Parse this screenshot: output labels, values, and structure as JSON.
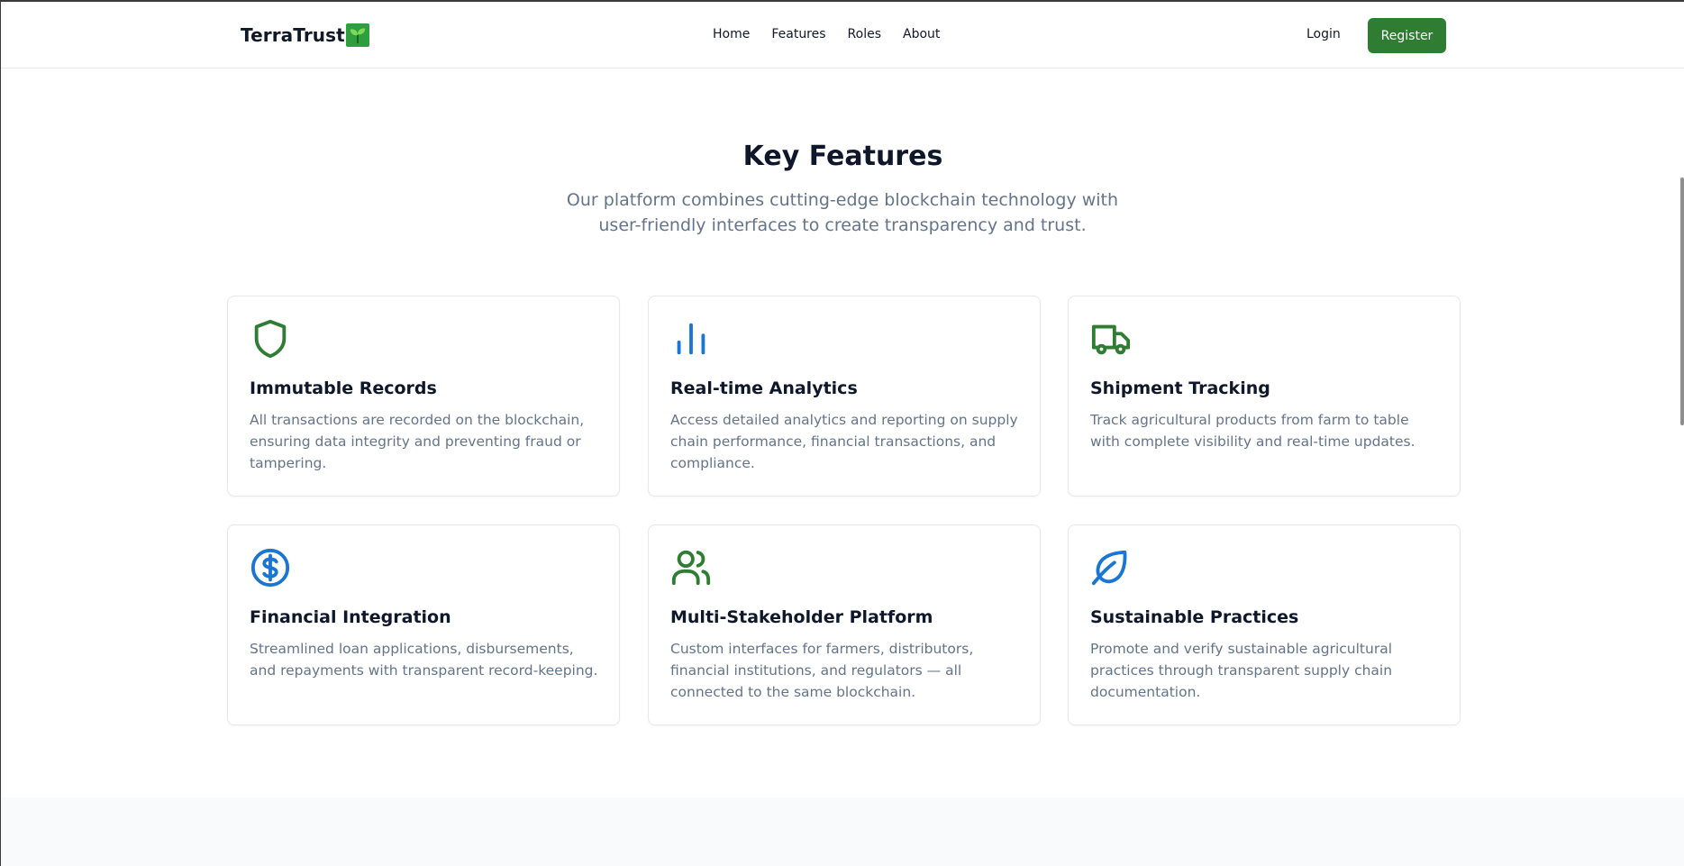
{
  "navbar": {
    "brand": "TerraTrust",
    "brand_icon": "seedling-icon",
    "links": [
      "Home",
      "Features",
      "Roles",
      "About"
    ],
    "login_label": "Login",
    "register_label": "Register"
  },
  "features": {
    "title": "Key Features",
    "subtitle": "Our platform combines cutting-edge blockchain technology with user-friendly interfaces to create transparency and trust.",
    "cards": [
      {
        "icon": "shield-icon",
        "title": "Immutable Records",
        "text": "All transactions are recorded on the blockchain, ensuring data integrity and preventing fraud or tampering."
      },
      {
        "icon": "bar-chart-icon",
        "title": "Real-time Analytics",
        "text": "Access detailed analytics and reporting on supply chain performance, financial transactions, and compliance."
      },
      {
        "icon": "truck-icon",
        "title": "Shipment Tracking",
        "text": "Track agricultural products from farm to table with complete visibility and real-time updates."
      },
      {
        "icon": "dollar-circle-icon",
        "title": "Financial Integration",
        "text": "Streamlined loan applications, disbursements, and repayments with transparent record-keeping."
      },
      {
        "icon": "users-icon",
        "title": "Multi-Stakeholder Platform",
        "text": "Custom interfaces for farmers, distributors, financial institutions, and regulators — all connected to the same blockchain."
      },
      {
        "icon": "leaf-icon",
        "title": "Sustainable Practices",
        "text": "Promote and verify sustainable agricultural practices through transparent supply chain documentation."
      }
    ]
  },
  "colors": {
    "brand_green": "#2e7d32",
    "accent_blue": "#1976d2",
    "muted_text": "#64748b"
  }
}
